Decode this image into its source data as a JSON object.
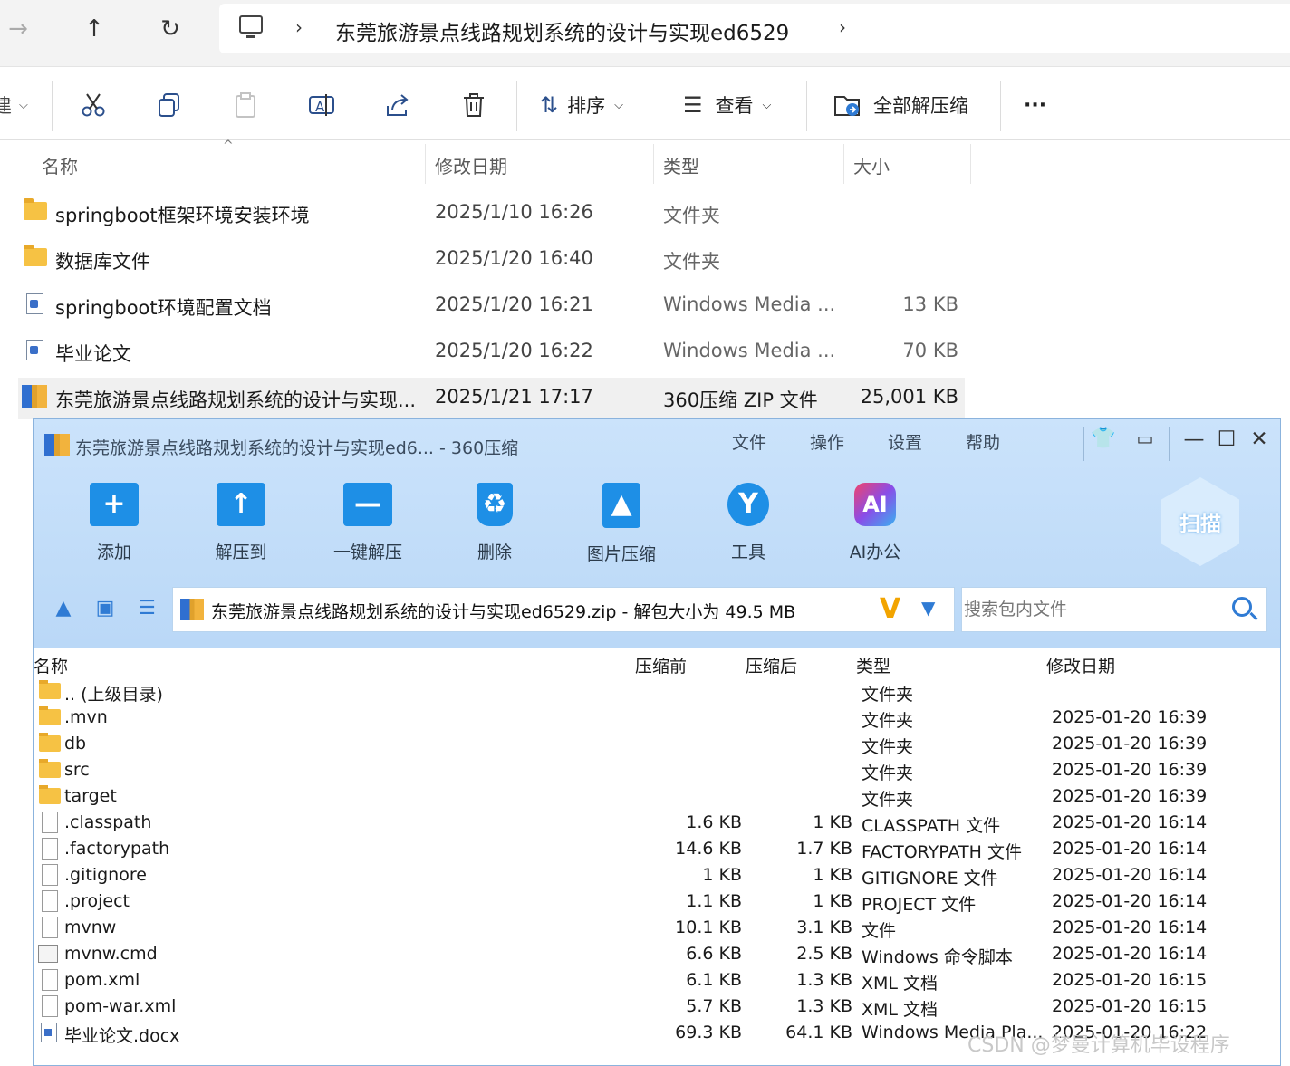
{
  "explorer": {
    "nav": {
      "forward": "→",
      "up": "↑",
      "refresh": "↻"
    },
    "breadcrumb": {
      "sep": "›",
      "folder": "东莞旅游景点线路规划系统的设计与实现ed6529",
      "sep2": "›"
    },
    "toolbar": {
      "new_fragment": "建",
      "sort_label": "排序",
      "view_label": "查看",
      "extract_all": "全部解压缩",
      "more": "···"
    },
    "columns": {
      "name": "名称",
      "date": "修改日期",
      "type": "类型",
      "size": "大小"
    },
    "files": [
      {
        "name": "springboot框架环境安装环境",
        "date": "2025/1/10 16:26",
        "type": "文件夹",
        "size": ""
      },
      {
        "name": "数据库文件",
        "date": "2025/1/20 16:40",
        "type": "文件夹",
        "size": ""
      },
      {
        "name": "springboot环境配置文档",
        "date": "2025/1/20 16:21",
        "type": "Windows Media ...",
        "size": "13 KB"
      },
      {
        "name": "毕业论文",
        "date": "2025/1/20 16:22",
        "type": "Windows Media ...",
        "size": "70 KB"
      },
      {
        "name": "东莞旅游景点线路规划系统的设计与实现...",
        "date": "2025/1/21 17:17",
        "type": "360压缩 ZIP 文件",
        "size": "25,001 KB"
      }
    ]
  },
  "archiver": {
    "title": "东莞旅游景点线路规划系统的设计与实现ed6... - 360压缩",
    "menu": [
      "文件",
      "操作",
      "设置",
      "帮助"
    ],
    "controls": {
      "minimize": "—",
      "maximize": "☐",
      "close": "✕"
    },
    "tools": [
      {
        "label": "添加",
        "icon": "add-folder-icon",
        "color": "#1e8fe6",
        "glyph": "+"
      },
      {
        "label": "解压到",
        "icon": "extract-to-icon",
        "color": "#1e8fe6",
        "glyph": "↑"
      },
      {
        "label": "一键解压",
        "icon": "one-click-extract-icon",
        "color": "#1e8fe6",
        "glyph": "—"
      },
      {
        "label": "删除",
        "icon": "delete-bin-icon",
        "color": "#2a9ae8",
        "glyph": "♻"
      },
      {
        "label": "图片压缩",
        "icon": "image-compress-icon",
        "color": "#1e8fe6",
        "glyph": "▲"
      },
      {
        "label": "工具",
        "icon": "tools-icon",
        "color": "#1e8fe6",
        "glyph": "Y"
      },
      {
        "label": "AI办公",
        "icon": "ai-office-icon",
        "color": "#e8447a",
        "glyph": "AI"
      }
    ],
    "scan_label": "扫描",
    "path_text": "东莞旅游景点线路规划系统的设计与实现ed6529.zip - 解包大小为 49.5 MB",
    "v_badge": "V",
    "dropdown": "▼",
    "search_placeholder": "搜索包内文件",
    "columns": {
      "name": "名称",
      "before": "压缩前",
      "after": "压缩后",
      "type": "类型",
      "date": "修改日期"
    },
    "entries": [
      {
        "icon": "folder",
        "name": ".. (上级目录)",
        "before": "",
        "after": "",
        "type": "文件夹",
        "date": ""
      },
      {
        "icon": "folder",
        "name": ".mvn",
        "before": "",
        "after": "",
        "type": "文件夹",
        "date": "2025-01-20 16:39"
      },
      {
        "icon": "folder",
        "name": "db",
        "before": "",
        "after": "",
        "type": "文件夹",
        "date": "2025-01-20 16:39"
      },
      {
        "icon": "folder",
        "name": "src",
        "before": "",
        "after": "",
        "type": "文件夹",
        "date": "2025-01-20 16:39"
      },
      {
        "icon": "folder",
        "name": "target",
        "before": "",
        "after": "",
        "type": "文件夹",
        "date": "2025-01-20 16:39"
      },
      {
        "icon": "file",
        "name": ".classpath",
        "before": "1.6 KB",
        "after": "1 KB",
        "type": "CLASSPATH 文件",
        "date": "2025-01-20 16:14"
      },
      {
        "icon": "file",
        "name": ".factorypath",
        "before": "14.6 KB",
        "after": "1.7 KB",
        "type": "FACTORYPATH 文件",
        "date": "2025-01-20 16:14"
      },
      {
        "icon": "file",
        "name": ".gitignore",
        "before": "1 KB",
        "after": "1 KB",
        "type": "GITIGNORE 文件",
        "date": "2025-01-20 16:14"
      },
      {
        "icon": "file",
        "name": ".project",
        "before": "1.1 KB",
        "after": "1 KB",
        "type": "PROJECT 文件",
        "date": "2025-01-20 16:14"
      },
      {
        "icon": "file",
        "name": "mvnw",
        "before": "10.1 KB",
        "after": "3.1 KB",
        "type": "文件",
        "date": "2025-01-20 16:14"
      },
      {
        "icon": "cmd",
        "name": "mvnw.cmd",
        "before": "6.6 KB",
        "after": "2.5 KB",
        "type": "Windows 命令脚本",
        "date": "2025-01-20 16:14"
      },
      {
        "icon": "file",
        "name": "pom.xml",
        "before": "6.1 KB",
        "after": "1.3 KB",
        "type": "XML 文档",
        "date": "2025-01-20 16:15"
      },
      {
        "icon": "file",
        "name": "pom-war.xml",
        "before": "5.7 KB",
        "after": "1.3 KB",
        "type": "XML 文档",
        "date": "2025-01-20 16:15"
      },
      {
        "icon": "wmv",
        "name": "毕业论文.docx",
        "before": "69.3 KB",
        "after": "64.1 KB",
        "type": "Windows Media Pla...",
        "date": "2025-01-20 16:22"
      }
    ]
  },
  "watermark": "CSDN @梦曼计算机毕设程序"
}
